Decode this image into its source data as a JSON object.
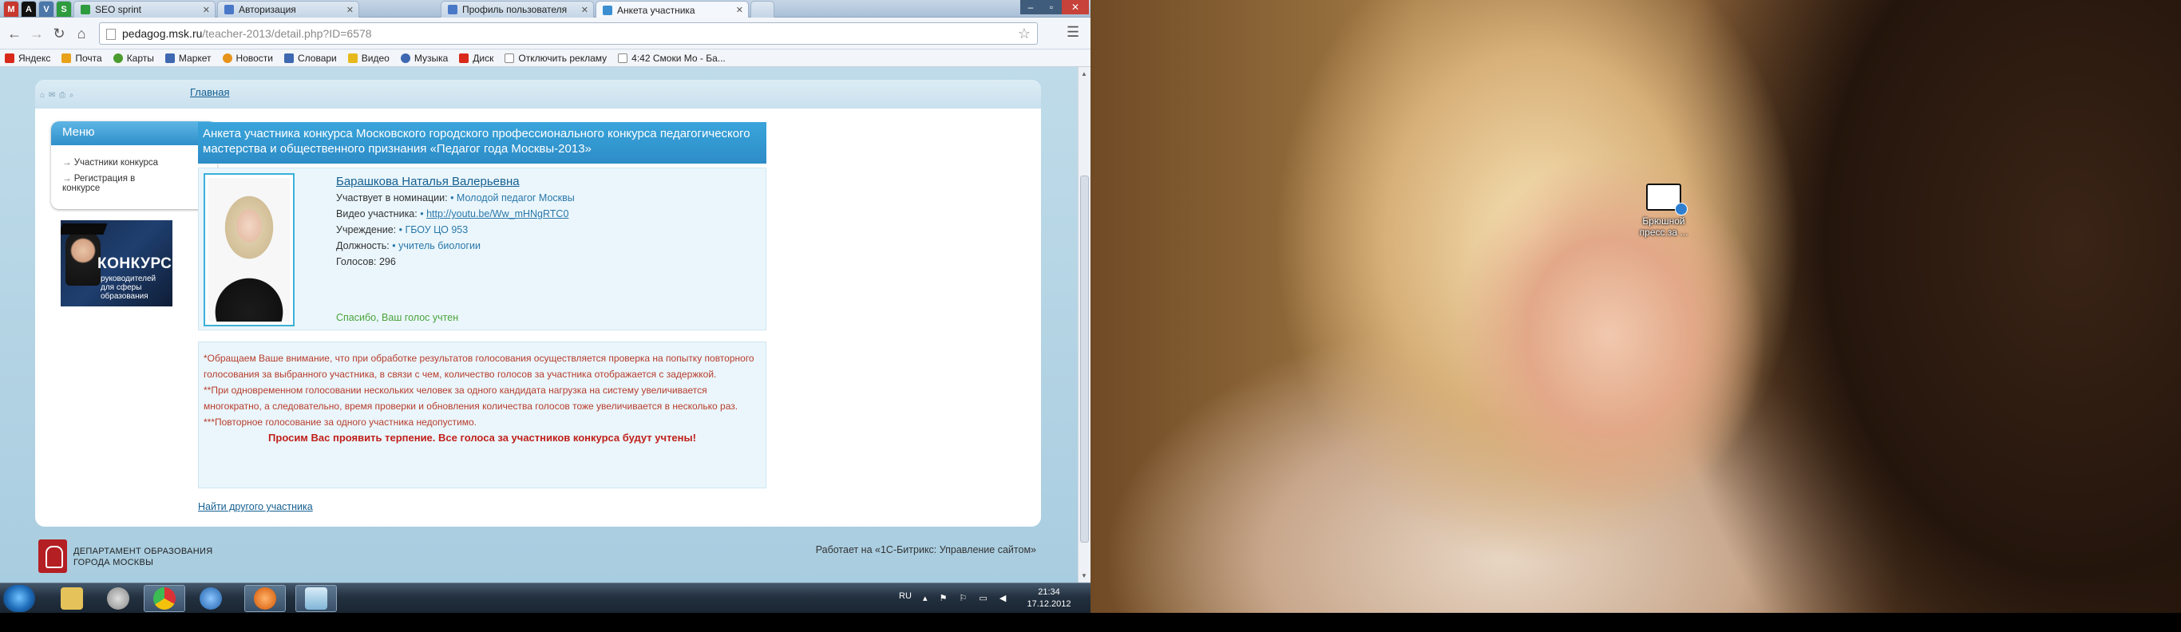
{
  "browser": {
    "tabs": [
      {
        "label": "SEO sprint",
        "color": "#2e9b3e"
      },
      {
        "label": "Авторизация",
        "color": "#4a78c8"
      },
      {
        "label": "Профиль пользователя",
        "color": "#4a78c8"
      },
      {
        "label": "Анкета участника",
        "color": "#3b8fd0",
        "active": true
      }
    ],
    "pinned_tabs": [
      "pinned-gmail",
      "pinned-a",
      "pinned-v",
      "pinned-s"
    ],
    "url": {
      "host": "pedagog.msk.ru",
      "path": "/teacher-2013/detail.php?ID=6578"
    },
    "bookmarks": [
      "Яндекс",
      "Почта",
      "Карты",
      "Маркет",
      "Новости",
      "Словари",
      "Видео",
      "Музыка",
      "Диск",
      "Отключить рекламу",
      "4:42 Смоки Мо - Ба..."
    ]
  },
  "page": {
    "breadcrumb": "Главная",
    "menu": {
      "title": "Меню",
      "items": [
        "Участники конкурса",
        "Регистрация в конкурсе"
      ]
    },
    "konkurs_banner": {
      "title": "КОНКУРС",
      "subtitle": "руководителей для сферы образования"
    },
    "title": "Анкета участника конкурса Московского городского профессионального конкурса педагогического мастерства и общественного признания «Педагог года Москвы-2013»",
    "participant": {
      "name": "Барашкова Наталья Валерьевна",
      "nomination_label": "Участвует в номинации:",
      "nomination": "• Молодой педагог Москвы",
      "video_label": "Видео участника:",
      "video_bullet": "•",
      "video": "http://youtu.be/Ww_mHNgRTC0",
      "school_label": "Учреждение:",
      "school": "• ГБОУ ЦО 953",
      "position_label": "Должность:",
      "position": "• учитель биологии",
      "votes_label": "Голосов:",
      "votes": "296",
      "thanks": "Спасибо, Ваш голос учтен"
    },
    "notices": [
      "*Обращаем Ваше внимание, что при обработке результатов голосования осуществляется проверка на попытку повторного голосования за выбранного участника, в связи с чем, количество голосов за участника отображается с задержкой.",
      "**При одновременном голосовании нескольких человек за одного кандидата нагрузка на систему увеличивается многократно, а следовательно, время проверки и обновления количества голосов тоже увеличивается в несколько раз.",
      "***Повторное голосование за одного участника недопустимо."
    ],
    "notice_bold": "Просим Вас проявить терпение. Все голоса за участников конкурса будут учтены!",
    "find_link": "Найти другого участника",
    "footer": {
      "department_line1": "ДЕПАРТАМЕНТ ОБРАЗОВАНИЯ",
      "department_line2": "ГОРОДА МОСКВЫ",
      "bitrix": "Работает на «1С-Битрикс: Управление сайтом»"
    }
  },
  "taskbar": {
    "lang": "RU",
    "time": "21:34",
    "date": "17.12.2012"
  },
  "desktop": {
    "icon_label": "Брюшной пресс.за ..."
  }
}
